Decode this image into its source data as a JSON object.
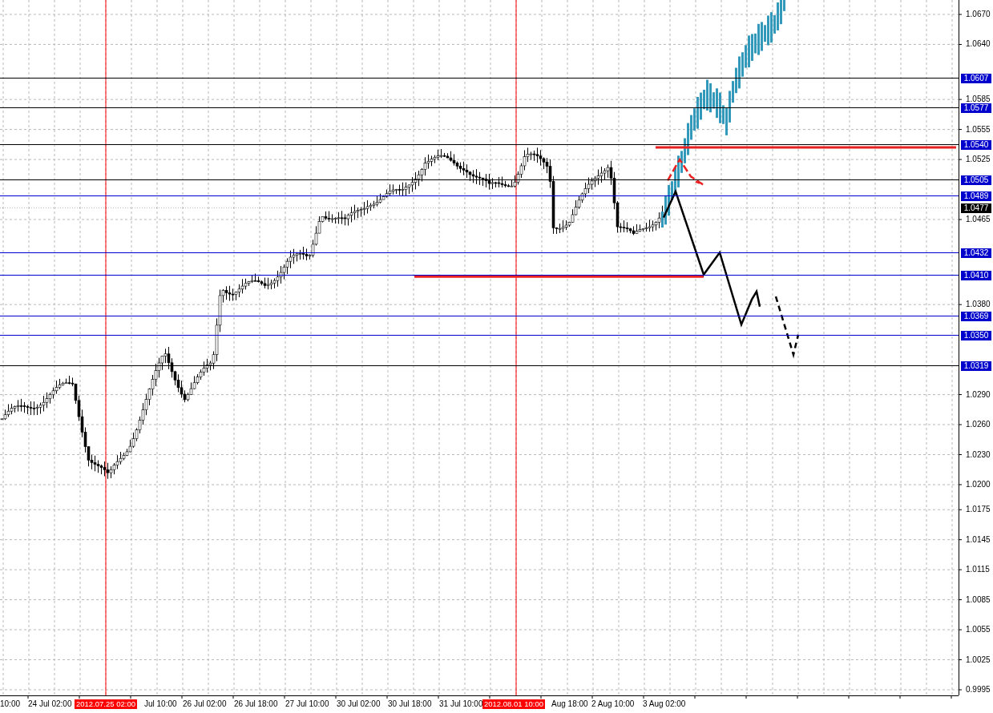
{
  "price_axis": {
    "labels": [
      "1.0670",
      "1.0640",
      "1.0585",
      "1.0555",
      "1.0525",
      "1.0465",
      "1.0380",
      "1.0290",
      "1.0260",
      "1.0230",
      "1.0200",
      "1.0175",
      "1.0145",
      "1.0115",
      "1.0085",
      "1.0055",
      "1.0025",
      "0.9995"
    ]
  },
  "levels": [
    {
      "price": "1.0607",
      "kind": "line",
      "color": "#000000"
    },
    {
      "price": "1.0577",
      "kind": "line",
      "color": "#000000"
    },
    {
      "price": "1.0540",
      "kind": "line",
      "color": "#000000"
    },
    {
      "price": "1.0505",
      "kind": "line",
      "color": "#000000"
    },
    {
      "price": "1.0489",
      "kind": "line",
      "color": "#0000cc"
    },
    {
      "price": "1.0477",
      "kind": "current",
      "color": "#000000"
    },
    {
      "price": "1.0432",
      "kind": "line",
      "color": "#0000cc"
    },
    {
      "price": "1.0410",
      "kind": "line",
      "color": "#0000cc"
    },
    {
      "price": "1.0369",
      "kind": "line",
      "color": "#0000cc"
    },
    {
      "price": "1.0350",
      "kind": "line",
      "color": "#0000cc"
    },
    {
      "price": "1.0319",
      "kind": "line",
      "color": "#000000"
    }
  ],
  "time_axis": {
    "labels": [
      {
        "text": "10:00",
        "kind": "tick"
      },
      {
        "text": "24 Jul 02:00",
        "kind": "tick"
      },
      {
        "text": "2012.07.25 02:00",
        "kind": "marker"
      },
      {
        "text": "Jul 10:00",
        "kind": "tick"
      },
      {
        "text": "26 Jul 02:00",
        "kind": "tick"
      },
      {
        "text": "26 Jul 18:00",
        "kind": "tick"
      },
      {
        "text": "27 Jul 10:00",
        "kind": "tick"
      },
      {
        "text": "30 Jul 02:00",
        "kind": "tick"
      },
      {
        "text": "30 Jul 18:00",
        "kind": "tick"
      },
      {
        "text": "31 Jul 10:00",
        "kind": "tick"
      },
      {
        "text": "2012.08.01 10:00",
        "kind": "marker"
      },
      {
        "text": "Aug 18:00",
        "kind": "tick"
      },
      {
        "text": "2 Aug 10:00",
        "kind": "tick"
      },
      {
        "text": "3 Aug 02:00",
        "kind": "tick"
      }
    ]
  }
}
